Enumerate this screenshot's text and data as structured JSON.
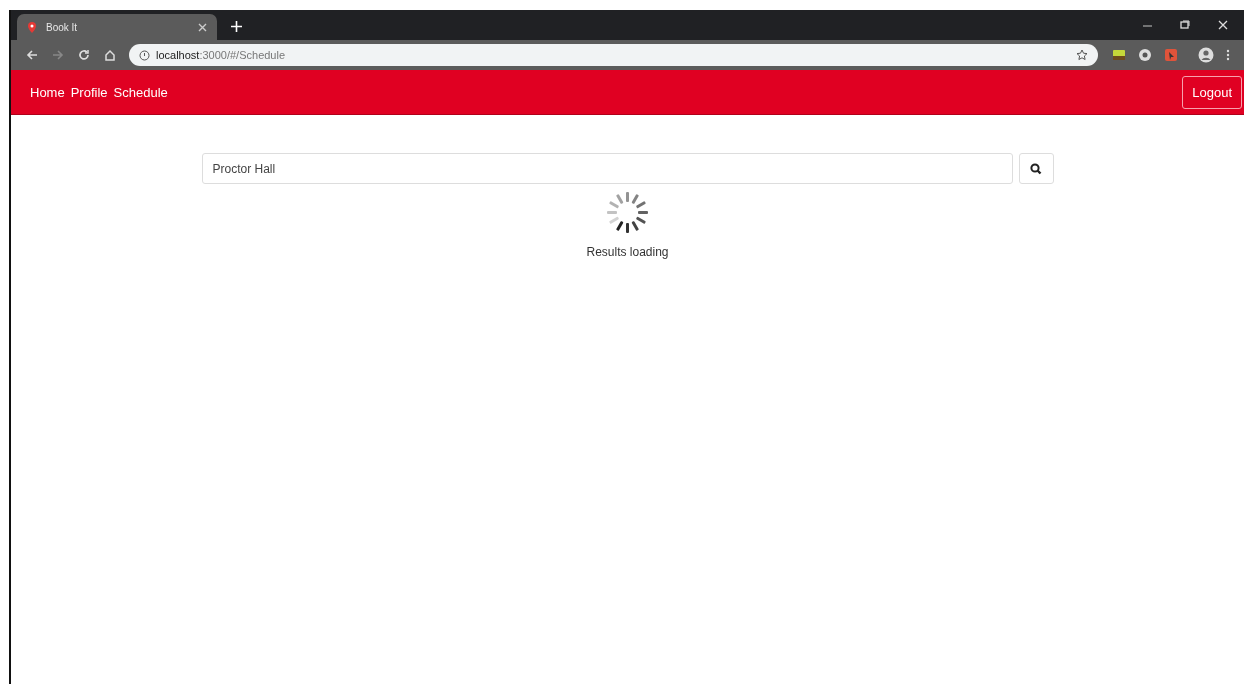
{
  "browser": {
    "tab": {
      "title": "Book It",
      "selected": true
    },
    "url": "**localhost**:3000/#/Schedule"
  },
  "navbar": {
    "links": [
      {
        "label": "Home"
      },
      {
        "label": "Profile"
      },
      {
        "label": "Schedule"
      }
    ],
    "logout": "Logout"
  },
  "search": {
    "value": "Proctor Hall"
  },
  "status": "Results loading"
}
